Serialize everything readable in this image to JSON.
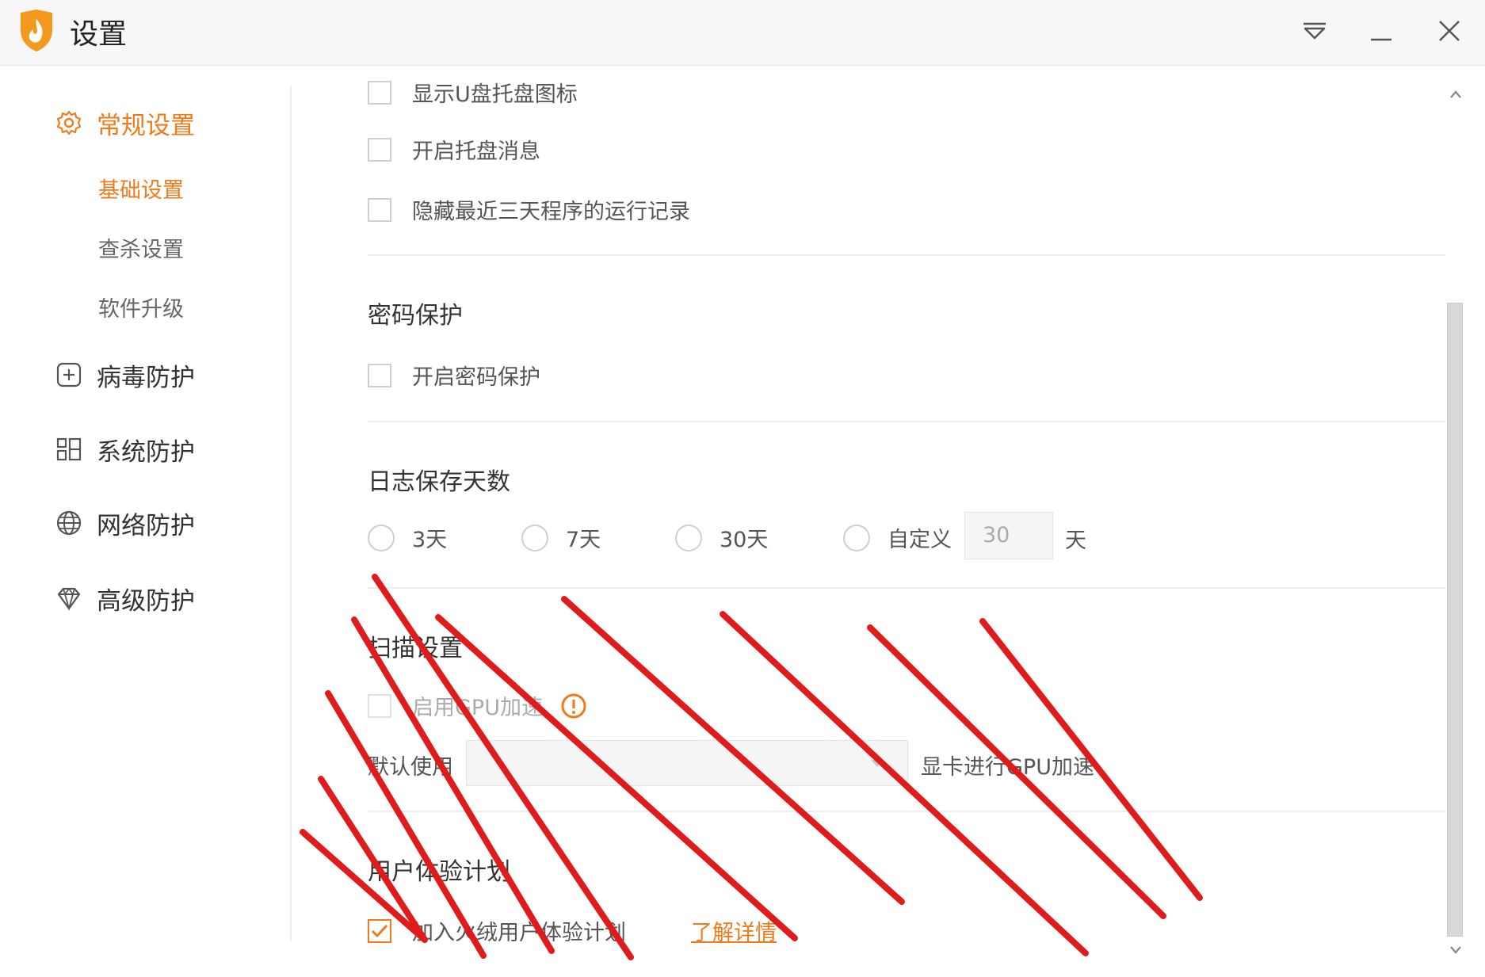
{
  "window": {
    "title": "设置"
  },
  "sidebar": {
    "general": "常规设置",
    "sub_items": [
      "基础设置",
      "查杀设置",
      "软件升级"
    ],
    "virus": "病毒防护",
    "system": "系统防护",
    "network": "网络防护",
    "advanced": "高级防护"
  },
  "tray": {
    "show_u_disk": "显示U盘托盘图标",
    "enable_messages": "开启托盘消息",
    "hide_records": "隐藏最近三天程序的运行记录"
  },
  "password": {
    "title": "密码保护",
    "enable": "开启密码保护"
  },
  "log_days": {
    "title": "日志保存天数",
    "options": [
      "3天",
      "7天",
      "30天",
      "自定义"
    ],
    "custom_value": "30",
    "unit": "天"
  },
  "scan": {
    "title": "扫描设置",
    "gpu_accel": "启用GPU加速",
    "default_use": "默认使用",
    "gpu_suffix": "显卡进行GPU加速"
  },
  "ux": {
    "title": "用户体验计划",
    "join": "加入火绒用户体验计划",
    "learn_more": "了解详情"
  },
  "colors": {
    "accent": "#f07b1d",
    "annotation": "#e01b1b"
  }
}
